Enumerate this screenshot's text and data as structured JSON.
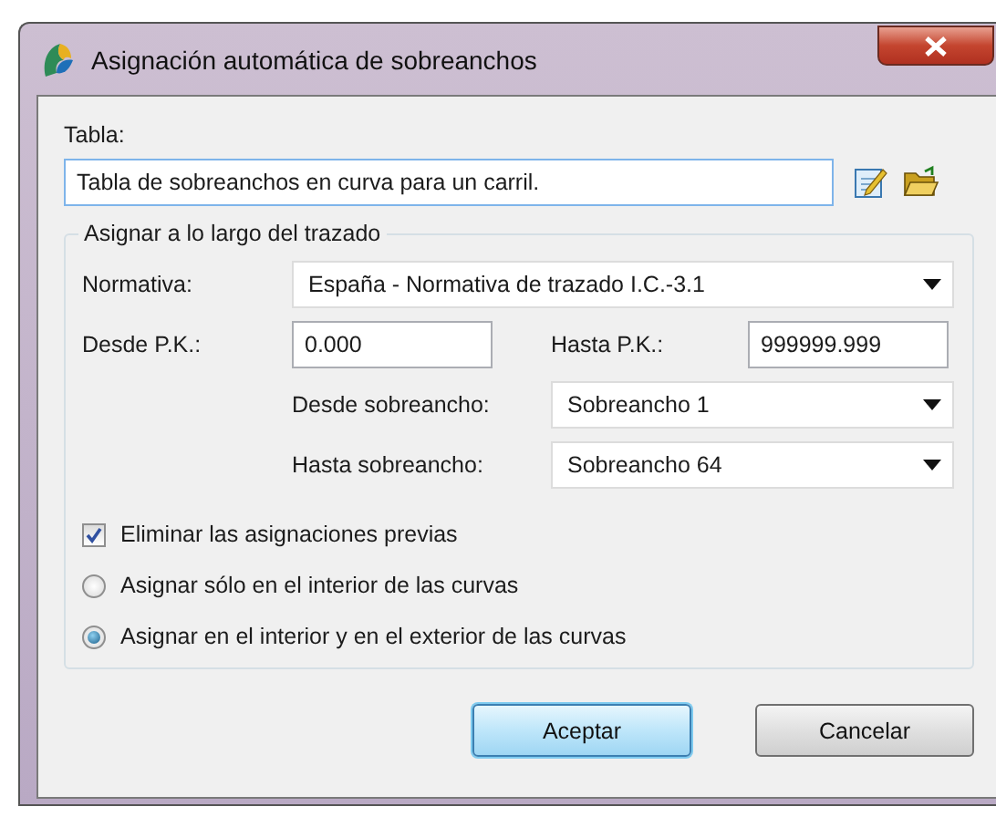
{
  "window": {
    "title": "Asignación automática de sobreanchos"
  },
  "tabla": {
    "label": "Tabla:",
    "value": "Tabla de sobreanchos en curva para un carril."
  },
  "group": {
    "title": "Asignar a lo largo del trazado",
    "normativa": {
      "label": "Normativa:",
      "value": "España - Normativa de trazado I.C.-3.1"
    },
    "desde_pk": {
      "label": "Desde P.K.:",
      "value": "0.000"
    },
    "hasta_pk": {
      "label": "Hasta P.K.:",
      "value": "999999.999"
    },
    "desde_sobreancho": {
      "label": "Desde sobreancho:",
      "value": "Sobreancho 1"
    },
    "hasta_sobreancho": {
      "label": "Hasta sobreancho:",
      "value": "Sobreancho 64"
    },
    "eliminar": {
      "label": "Eliminar las asignaciones previas",
      "checked": true
    },
    "options": [
      {
        "label": "Asignar sólo en el interior de las curvas",
        "selected": false
      },
      {
        "label": "Asignar en el interior y en el exterior de las curvas",
        "selected": true
      }
    ]
  },
  "buttons": [
    {
      "label": "Aceptar",
      "default": true
    },
    {
      "label": "Cancelar",
      "default": false
    }
  ]
}
